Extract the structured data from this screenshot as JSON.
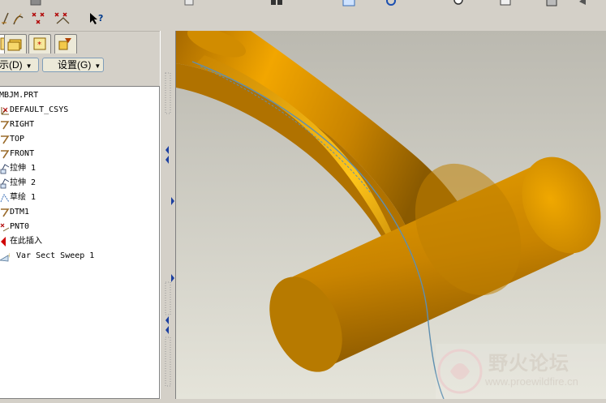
{
  "menus": {
    "show_label": "示(D)",
    "settings_label": "设置(G)"
  },
  "tree": {
    "items": [
      {
        "label": "MBJM.PRT",
        "icon": "part-icon"
      },
      {
        "label": "DEFAULT_CSYS",
        "icon": "csys-icon"
      },
      {
        "label": "RIGHT",
        "icon": "datum-plane-icon"
      },
      {
        "label": "TOP",
        "icon": "datum-plane-icon"
      },
      {
        "label": "FRONT",
        "icon": "datum-plane-icon"
      },
      {
        "label": "拉伸 1",
        "icon": "extrude-icon"
      },
      {
        "label": "拉伸 2",
        "icon": "extrude-icon"
      },
      {
        "label": "草绘 1",
        "icon": "sketch-icon"
      },
      {
        "label": "DTM1",
        "icon": "datum-plane-icon"
      },
      {
        "label": "PNT0",
        "icon": "datum-point-icon"
      },
      {
        "label": "在此插入",
        "icon": "insert-here-icon"
      },
      {
        "label": "Var Sect Sweep 1",
        "icon": "sweep-icon"
      }
    ]
  },
  "watermark": {
    "name": "野火论坛",
    "url": "www.proewildfire.cn"
  },
  "colors": {
    "model_orange": "#d99100",
    "background_top": "#bdbbb2",
    "background_bottom": "#e3e2d8",
    "curve_blue": "#5f8fb0"
  }
}
